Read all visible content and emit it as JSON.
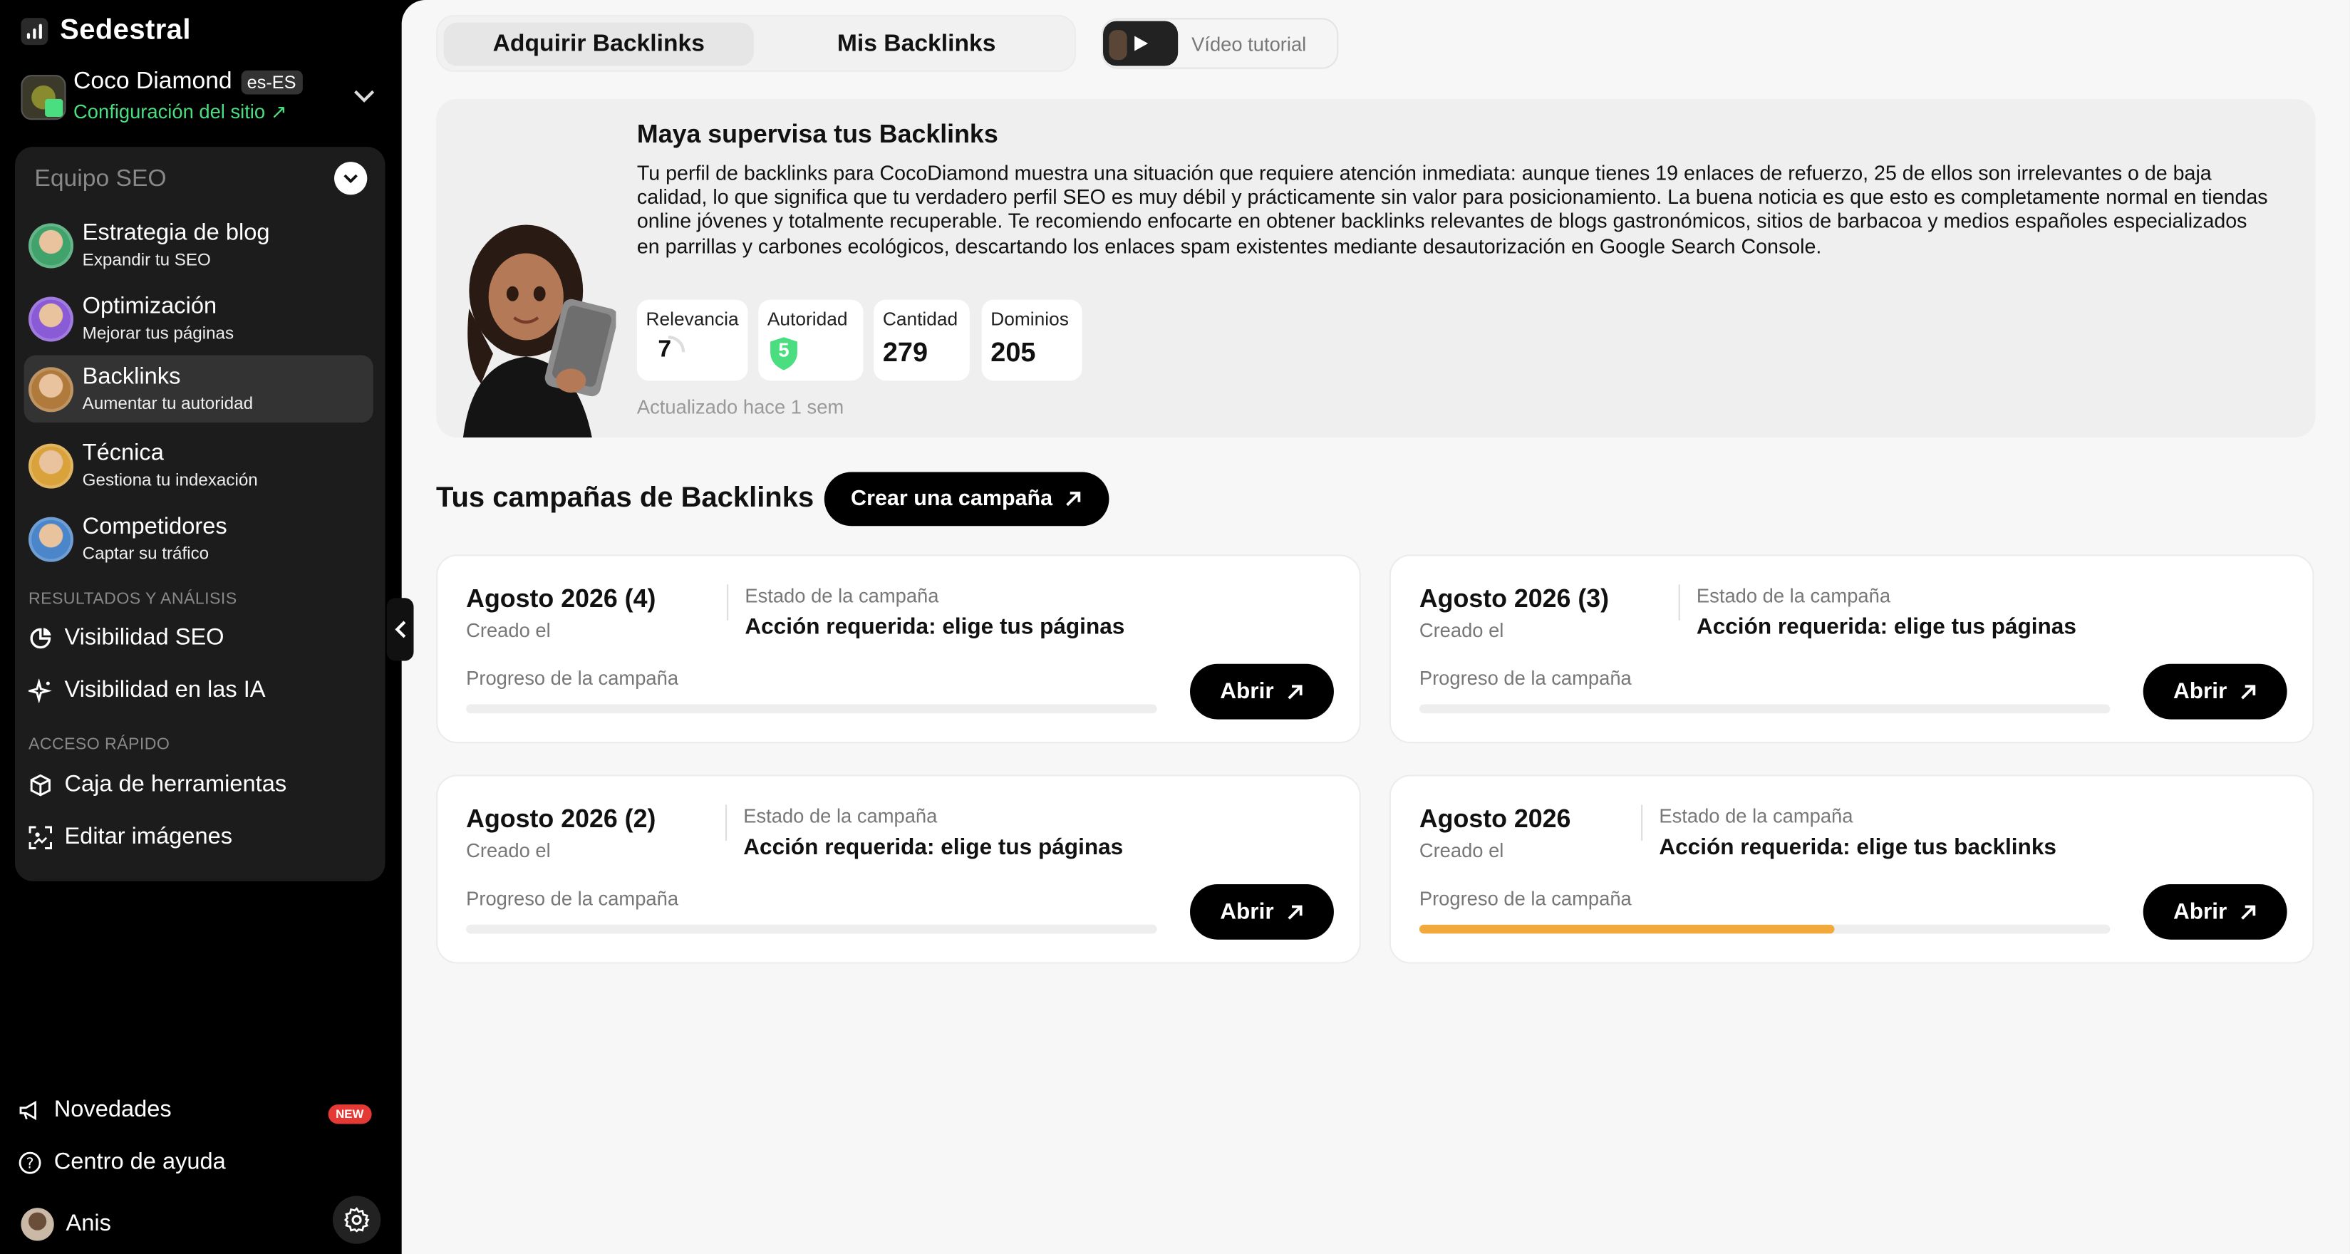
{
  "brand": {
    "name": "Sedestral"
  },
  "site": {
    "name": "Coco Diamond",
    "lang": "es-ES",
    "config_label": "Configuración del sitio",
    "config_arrow": "↗"
  },
  "seo_team": {
    "title": "Equipo SEO",
    "agents": [
      {
        "title": "Estrategia de blog",
        "subtitle": "Expandir tu SEO",
        "color": "#3fa36b"
      },
      {
        "title": "Optimización",
        "subtitle": "Mejorar tus páginas",
        "color": "#8a5bd6"
      },
      {
        "title": "Backlinks",
        "subtitle": "Aumentar tu autoridad",
        "color": "#b07a3c"
      },
      {
        "title": "Técnica",
        "subtitle": "Gestiona tu indexación",
        "color": "#d9a23a"
      },
      {
        "title": "Competidores",
        "subtitle": "Captar su tráfico",
        "color": "#4a86c9"
      }
    ]
  },
  "results": {
    "label": "RESULTADOS Y ANÁLISIS",
    "items": [
      {
        "label": "Visibilidad SEO",
        "icon": "chart-pie-icon"
      },
      {
        "label": "Visibilidad en las IA",
        "icon": "sparkles-icon"
      }
    ]
  },
  "quick_access": {
    "label": "ACCESO RÁPIDO",
    "items": [
      {
        "label": "Caja de herramientas",
        "icon": "cube-icon"
      },
      {
        "label": "Editar imágenes",
        "icon": "image-edit-icon"
      }
    ]
  },
  "bottom": {
    "news_label": "Novedades",
    "news_badge": "NEW",
    "help_label": "Centro de ayuda",
    "user_name": "Anis"
  },
  "tabs": [
    {
      "label": "Adquirir Backlinks",
      "active": true
    },
    {
      "label": "Mis Backlinks",
      "active": false
    }
  ],
  "video": {
    "label": "Vídeo tutorial"
  },
  "maya": {
    "title": "Maya supervisa tus Backlinks",
    "text": "Tu perfil de backlinks para CocoDiamond muestra una situación que requiere atención inmediata: aunque tienes 19 enlaces de refuerzo, 25 de ellos son irrelevantes o de baja calidad, lo que significa que tu verdadero perfil SEO es muy débil y prácticamente sin valor para posicionamiento. La buena noticia es que esto es completamente normal en tiendas online jóvenes y totalmente recuperable. Te recomiendo enfocarte en obtener backlinks relevantes de blogs gastronómicos, sitios de barbacoa y medios españoles especializados en parrillas y carbones ecológicos, descartando los enlaces spam existentes mediante desautorización en Google Search Console.",
    "metrics": [
      {
        "label": "Relevancia",
        "value": "7"
      },
      {
        "label": "Autoridad",
        "value": "5"
      },
      {
        "label": "Cantidad",
        "value": "279"
      },
      {
        "label": "Dominios",
        "value": "205"
      }
    ],
    "updated": "Actualizado hace 1 sem"
  },
  "campaigns_section": {
    "title": "Tus campañas de Backlinks",
    "create_label": "Crear una campaña"
  },
  "campaigns": [
    {
      "name": "Agosto 2026 (4)",
      "created": "Creado el",
      "status_label": "Estado de la campaña",
      "status": "Acción requerida: elige tus páginas",
      "progress_label": "Progreso de la campaña",
      "progress": 0,
      "open_label": "Abrir"
    },
    {
      "name": "Agosto 2026 (3)",
      "created": "Creado el",
      "status_label": "Estado de la campaña",
      "status": "Acción requerida: elige tus páginas",
      "progress_label": "Progreso de la campaña",
      "progress": 0,
      "open_label": "Abrir"
    },
    {
      "name": "Agosto 2026 (2)",
      "created": "Creado el",
      "status_label": "Estado de la campaña",
      "status": "Acción requerida: elige tus páginas",
      "progress_label": "Progreso de la campaña",
      "progress": 0,
      "open_label": "Abrir"
    },
    {
      "name": "Agosto 2026",
      "created": "Creado el",
      "status_label": "Estado de la campaña",
      "status": "Acción requerida: elige tus backlinks",
      "progress_label": "Progreso de la campaña",
      "progress": 0.6,
      "open_label": "Abrir"
    }
  ],
  "colors": {
    "accent_green": "#4ade80",
    "progress_orange": "#f2a93b",
    "badge_red": "#e53935"
  }
}
